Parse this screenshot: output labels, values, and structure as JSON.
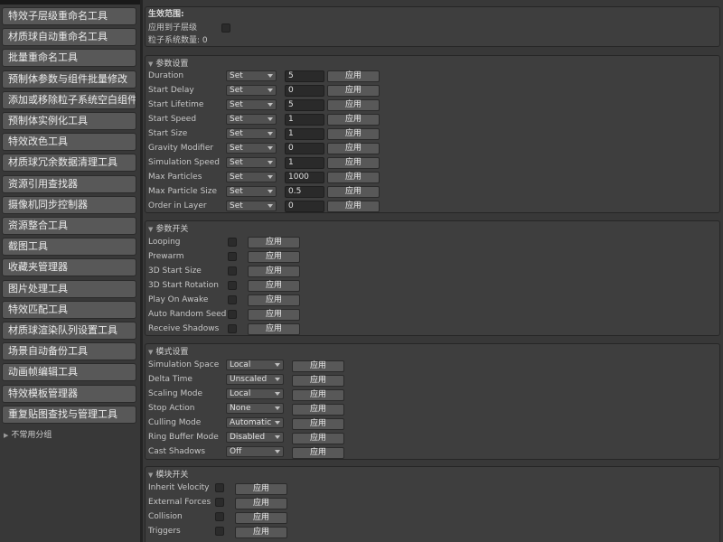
{
  "sidebar": {
    "tools": [
      "特效子层级重命名工具",
      "材质球自动重命名工具",
      "批量重命名工具",
      "预制体参数与组件批量修改",
      "添加或移除粒子系统空白组件",
      "预制体实例化工具",
      "特效改色工具",
      "材质球冗余数据清理工具",
      "资源引用查找器",
      "摄像机同步控制器",
      "资源整合工具",
      "截图工具",
      "收藏夹管理器",
      "图片处理工具",
      "特效匹配工具",
      "材质球渲染队列设置工具",
      "场景自动备份工具",
      "动画帧编辑工具",
      "特效模板管理器",
      "重复贴图查找与管理工具"
    ],
    "group_label": "不常用分组"
  },
  "scope": {
    "title": "生效范围:",
    "apply_children_label": "应用到子层级",
    "count_text": "粒子系统数量: 0"
  },
  "apply_label": "应用",
  "params": {
    "title": "参数设置",
    "rows": [
      {
        "label": "Duration",
        "mode": "Set",
        "value": "5"
      },
      {
        "label": "Start Delay",
        "mode": "Set",
        "value": "0"
      },
      {
        "label": "Start Lifetime",
        "mode": "Set",
        "value": "5"
      },
      {
        "label": "Start Speed",
        "mode": "Set",
        "value": "1"
      },
      {
        "label": "Start Size",
        "mode": "Set",
        "value": "1"
      },
      {
        "label": "Gravity Modifier",
        "mode": "Set",
        "value": "0"
      },
      {
        "label": "Simulation Speed",
        "mode": "Set",
        "value": "1"
      },
      {
        "label": "Max Particles",
        "mode": "Set",
        "value": "1000"
      },
      {
        "label": "Max Particle Size",
        "mode": "Set",
        "value": "0.5"
      },
      {
        "label": "Order in Layer",
        "mode": "Set",
        "value": "0"
      }
    ]
  },
  "switches": {
    "title": "参数开关",
    "rows": [
      "Looping",
      "Prewarm",
      "3D Start Size",
      "3D Start Rotation",
      "Play On Awake",
      "Auto Random Seed",
      "Receive Shadows"
    ]
  },
  "modes": {
    "title": "模式设置",
    "rows": [
      {
        "label": "Simulation Space",
        "value": "Local"
      },
      {
        "label": "Delta Time",
        "value": "Unscaled"
      },
      {
        "label": "Scaling Mode",
        "value": "Local"
      },
      {
        "label": "Stop Action",
        "value": "None"
      },
      {
        "label": "Culling Mode",
        "value": "Automatic"
      },
      {
        "label": "Ring Buffer Mode",
        "value": "Disabled"
      },
      {
        "label": "Cast Shadows",
        "value": "Off"
      }
    ]
  },
  "modules": {
    "title": "模块开关",
    "rows": [
      "Inherit Velocity",
      "External Forces",
      "Collision",
      "Triggers"
    ]
  }
}
